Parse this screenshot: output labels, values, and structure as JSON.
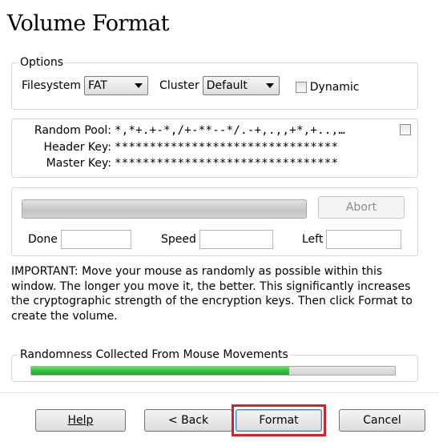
{
  "window": {
    "title": "Volume Format"
  },
  "options": {
    "legend": "Options",
    "filesystem_label": "Filesystem",
    "filesystem_value": "FAT",
    "cluster_label": "Cluster",
    "cluster_value": "Default",
    "dynamic_label": "Dynamic"
  },
  "keys": {
    "random_pool_label": "Random Pool:",
    "random_pool_value": "*,*+.+-*,/+-**--*/.-+,.,,+*,+..,…",
    "header_key_label": "Header Key:",
    "header_key_value": "********************************",
    "master_key_label": "Master Key:",
    "master_key_value": "********************************"
  },
  "progress": {
    "abort_label": "Abort",
    "done_label": "Done",
    "speed_label": "Speed",
    "left_label": "Left",
    "value": 0
  },
  "important_text": "IMPORTANT: Move your mouse as randomly as possible within this window. The longer you move it, the better. This significantly increases the cryptographic strength of the encryption keys. Then click Format to create the volume.",
  "randomness": {
    "legend": "Randomness Collected From Mouse Movements",
    "fraction": 0.71
  },
  "buttons": {
    "help": "Help",
    "back": "< Back",
    "format": "Format",
    "cancel": "Cancel"
  },
  "colors": {
    "highlight": "#d9202a",
    "randomness_fill": "#2fbe3a"
  }
}
